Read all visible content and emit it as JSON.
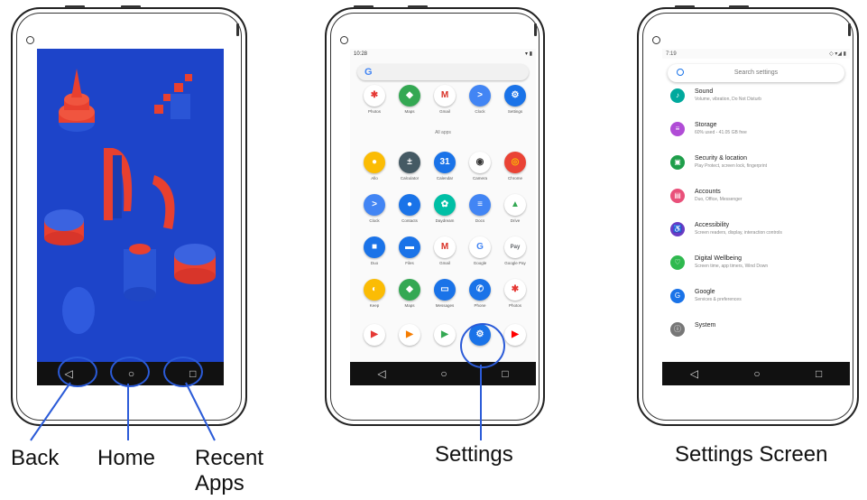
{
  "labels": {
    "back": "Back",
    "home": "Home",
    "recent": "Recent\nApps",
    "settings": "Settings",
    "settings_screen": "Settings Screen"
  },
  "drawer": {
    "time": "10:28",
    "search_letter": "G",
    "all_apps": "All apps",
    "rows": [
      [
        {
          "name": "Photos",
          "color": "#ffffff",
          "glyph": "✱",
          "fg": "#e53935"
        },
        {
          "name": "Maps",
          "color": "#34a853",
          "glyph": "◆",
          "fg": "#fff"
        },
        {
          "name": "Gmail",
          "color": "#ffffff",
          "glyph": "M",
          "fg": "#d93025"
        },
        {
          "name": "Clock",
          "color": "#4285f4",
          "glyph": ">",
          "fg": "#fff"
        },
        {
          "name": "Settings",
          "color": "#1a73e8",
          "glyph": "⚙",
          "fg": "#fff"
        }
      ],
      [
        {
          "name": "Allo",
          "color": "#fbbc04",
          "glyph": "●",
          "fg": "#fff"
        },
        {
          "name": "Calculator",
          "color": "#455a64",
          "glyph": "±",
          "fg": "#fff"
        },
        {
          "name": "Calendar",
          "color": "#1a73e8",
          "glyph": "31",
          "fg": "#fff"
        },
        {
          "name": "Camera",
          "color": "#ffffff",
          "glyph": "◉",
          "fg": "#333"
        },
        {
          "name": "Chrome",
          "color": "#ea4335",
          "glyph": "◎",
          "fg": "#fbbc04"
        }
      ],
      [
        {
          "name": "Clock",
          "color": "#4285f4",
          "glyph": ">",
          "fg": "#fff"
        },
        {
          "name": "Contacts",
          "color": "#1a73e8",
          "glyph": "●",
          "fg": "#fff"
        },
        {
          "name": "Daydream",
          "color": "#00bfa5",
          "glyph": "✿",
          "fg": "#fff"
        },
        {
          "name": "Docs",
          "color": "#4285f4",
          "glyph": "≡",
          "fg": "#fff"
        },
        {
          "name": "Drive",
          "color": "#ffffff",
          "glyph": "▲",
          "fg": "#34a853"
        }
      ],
      [
        {
          "name": "Duo",
          "color": "#1a73e8",
          "glyph": "■",
          "fg": "#fff"
        },
        {
          "name": "Files",
          "color": "#1a73e8",
          "glyph": "▬",
          "fg": "#fff"
        },
        {
          "name": "Gmail",
          "color": "#ffffff",
          "glyph": "M",
          "fg": "#d93025"
        },
        {
          "name": "Google",
          "color": "#ffffff",
          "glyph": "G",
          "fg": "#4285f4"
        },
        {
          "name": "Google Pay",
          "color": "#ffffff",
          "glyph": "Pay",
          "fg": "#5f6368"
        }
      ],
      [
        {
          "name": "Keep",
          "color": "#fbbc04",
          "glyph": "◐",
          "fg": "#fff"
        },
        {
          "name": "Maps",
          "color": "#34a853",
          "glyph": "◆",
          "fg": "#fff"
        },
        {
          "name": "Messages",
          "color": "#1a73e8",
          "glyph": "▭",
          "fg": "#fff"
        },
        {
          "name": "Phone",
          "color": "#1a73e8",
          "glyph": "✆",
          "fg": "#fff"
        },
        {
          "name": "Photos",
          "color": "#ffffff",
          "glyph": "✱",
          "fg": "#e53935"
        }
      ],
      [
        {
          "name": "",
          "color": "#ffffff",
          "glyph": "▶",
          "fg": "#e53935"
        },
        {
          "name": "",
          "color": "#ffffff",
          "glyph": "▶",
          "fg": "#f57c00"
        },
        {
          "name": "",
          "color": "#ffffff",
          "glyph": "▶",
          "fg": "#34a853"
        },
        {
          "name": "",
          "color": "#1a73e8",
          "glyph": "⚙",
          "fg": "#fff"
        },
        {
          "name": "",
          "color": "#ffffff",
          "glyph": "▶",
          "fg": "#ff0000"
        }
      ]
    ]
  },
  "settings": {
    "time": "7:19",
    "search_placeholder": "Search settings",
    "items": [
      {
        "title": "Sound",
        "sub": "Volume, vibration, Do Not Disturb",
        "color": "#00a99d",
        "glyph": "♪"
      },
      {
        "title": "Storage",
        "sub": "60% used - 41.05 GB free",
        "color": "#b04cd6",
        "glyph": "≡"
      },
      {
        "title": "Security & location",
        "sub": "Play Protect, screen lock, fingerprint",
        "color": "#1e9e4a",
        "glyph": "▣"
      },
      {
        "title": "Accounts",
        "sub": "Duo, Office, Messenger",
        "color": "#e9507a",
        "glyph": "▤"
      },
      {
        "title": "Accessibility",
        "sub": "Screen readers, display, interaction controls",
        "color": "#6a3bc5",
        "glyph": "♿"
      },
      {
        "title": "Digital Wellbeing",
        "sub": "Screen time, app timers, Wind Down",
        "color": "#2fb94f",
        "glyph": "♡"
      },
      {
        "title": "Google",
        "sub": "Services & preferences",
        "color": "#1a73e8",
        "glyph": "G"
      },
      {
        "title": "System",
        "sub": "",
        "color": "#777777",
        "glyph": "ⓘ"
      }
    ]
  },
  "nav": {
    "back": "◁",
    "home": "○",
    "recent": "□"
  },
  "colors": {
    "callout": "#2b5bd8",
    "wallpaper": "#1d44c9",
    "shape": "#e8402f"
  }
}
